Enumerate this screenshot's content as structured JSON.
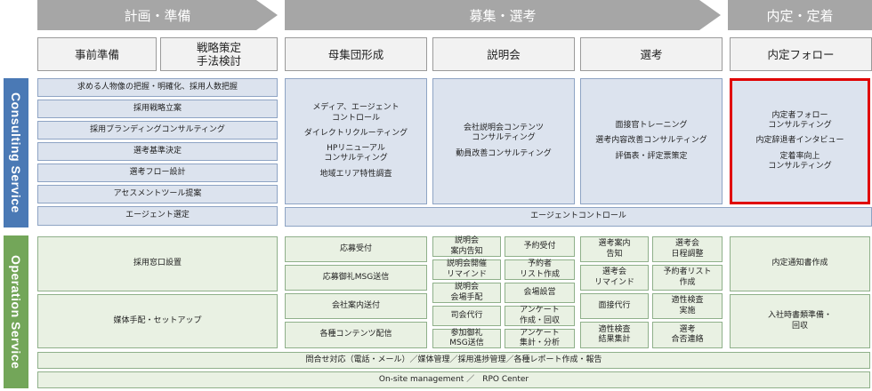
{
  "phases": {
    "planning": "計画・準備",
    "recruiting": "募集・選考",
    "offer": "内定・定着"
  },
  "columns": {
    "prep": "事前準備",
    "strategy": "戦略策定\n手法検討",
    "population": "母集団形成",
    "seminar": "説明会",
    "selection": "選考",
    "follow": "内定フォロー"
  },
  "colors": {
    "consulting": "#4a79b5",
    "operation": "#73a659",
    "highlight": "#e00000"
  },
  "consulting": {
    "label": "Consulting Service",
    "planning_items": [
      "求める人物像の把握・明確化、採用人数把握",
      "採用戦略立案",
      "採用ブランディングコンサルティング",
      "選考基準決定",
      "選考フロー設計",
      "アセスメントツール提案",
      "エージェント選定"
    ],
    "population_items": [
      "メディア、エージェント\nコントロール",
      "ダイレクトリクルーティング",
      "HPリニューアル\nコンサルティング",
      "地域エリア特性調査"
    ],
    "seminar_items": [
      "会社説明会コンテンツ\nコンサルティング",
      "動員改善コンサルティング"
    ],
    "selection_items": [
      "面接官トレーニング",
      "選考内容改善コンサルティング",
      "評価表・評定票策定"
    ],
    "follow_items": [
      "内定者フォロー\nコンサルティング",
      "内定辞退者インタビュー",
      "定着率向上\nコンサルティング"
    ],
    "agent_control": "エージェントコントロール"
  },
  "operation": {
    "label": "Operation Service",
    "planning_items": [
      "採用窓口設置",
      "媒体手配・セットアップ"
    ],
    "population_items": [
      "応募受付",
      "応募御礼MSG送信",
      "会社案内送付",
      "各種コンテンツ配信"
    ],
    "seminar_left": [
      "説明会\n案内告知",
      "説明会開催\nリマインド",
      "説明会\n会場手配",
      "司会代行",
      "参加御礼\nMSG送信"
    ],
    "seminar_right": [
      "予約受付",
      "予約者\nリスト作成",
      "会場設営",
      "アンケート\n作成・回収",
      "アンケート\n集計・分析"
    ],
    "selection_left": [
      "選考案内\n告知",
      "選考会\nリマインド",
      "面接代行",
      "適性検査\n結果集計"
    ],
    "selection_right": [
      "選考会\n日程調整",
      "予約者リスト\n作成",
      "適性検査\n実施",
      "選考\n合否連絡"
    ],
    "follow_items": [
      "内定通知書作成",
      "入社時書類準備・\n回収"
    ],
    "common_row": "問合せ対応（電話・メール）／媒体管理／採用進捗管理／各種レポート作成・報告",
    "onsite_row": "On-site management ／　RPO Center"
  }
}
